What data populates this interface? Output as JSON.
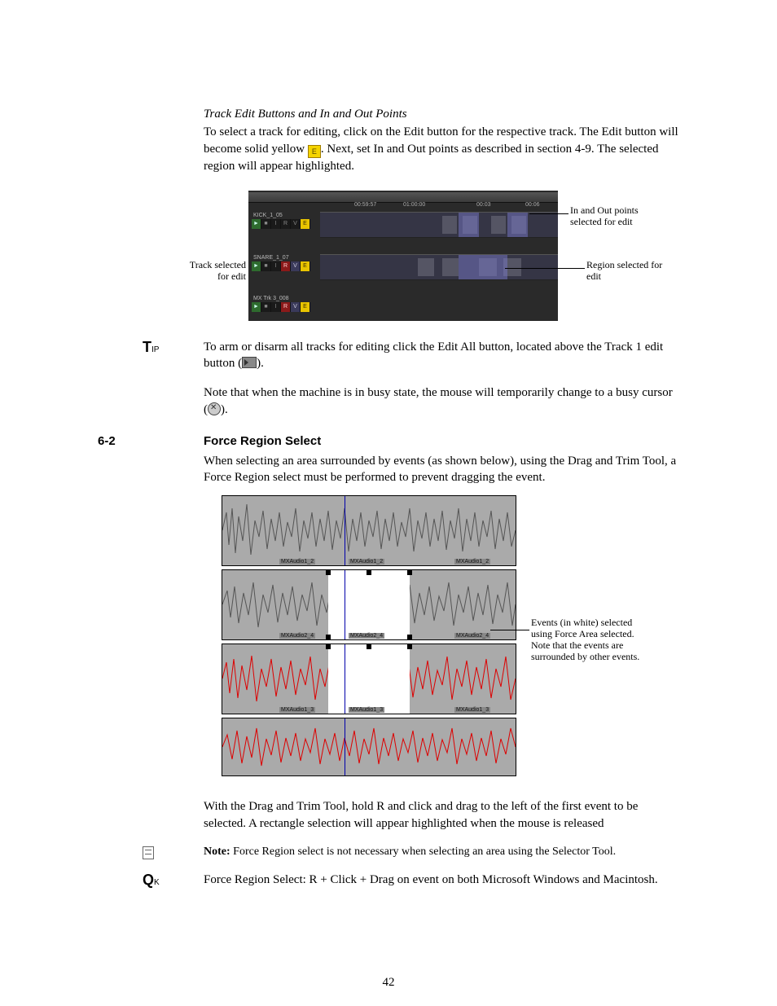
{
  "heading1": "Track Edit Buttons and In and Out Points",
  "para1a": "To select a track for editing, click on the Edit button for the respective track. The Edit button will become solid yellow ",
  "para1b": ". Next, set In and Out points as described in section 4-9. The selected region will appear highlighted.",
  "fig1": {
    "times": [
      "00:59:57",
      "01:00:00",
      "00:03",
      "00:06"
    ],
    "track_names": [
      "KICK_1_05",
      "SNARE_1_07",
      "MX Trk 3_008"
    ],
    "buttons": [
      "►",
      "■",
      "I",
      "R",
      "V",
      "E"
    ],
    "callout_left": "Track selected for edit",
    "callout_tr": "In and Out points selected for edit",
    "callout_r": "Region selected for edit"
  },
  "tip_label": "T",
  "tip_sub": "IP",
  "tip_para": "To arm or disarm all tracks for editing click the Edit All button, located above the Track 1 edit button (",
  "tip_para_end": ").",
  "busy_para_a": "Note that when the machine is in busy state, the mouse will temporarily change to a busy cursor (",
  "busy_para_b": ").",
  "section_num": "6-2",
  "section_title": "Force Region Select",
  "para2": "When selecting an area surrounded by events (as shown below), using the Drag and Trim Tool, a Force Region select must be performed to prevent dragging the event.",
  "fig2": {
    "labels_row1": [
      "MXAudio1_2",
      "MXAudio1_2",
      "MXAudio1_2"
    ],
    "labels_row2": [
      "MXAudio2_4",
      "MXAudio2_4",
      "MXAudio2_4"
    ],
    "labels_row3": [
      "MXAudio1_3",
      "MXAudio1_3",
      "MXAudio1_3"
    ],
    "callout": "Events (in white) selected using Force Area selected. Note that the events are surrounded by other events."
  },
  "para3": "With the Drag and Trim Tool, hold R and click and drag to the left of the first event to be selected. A rectangle selection will appear highlighted when the mouse is released",
  "note_bold": "Note:",
  "note_text": " Force Region select is not necessary when selecting an area using the Selector Tool.",
  "qk_label": "Q",
  "qk_sub": "K",
  "qk_text": "Force Region Select: R + Click + Drag on event on both Microsoft Windows and Macintosh.",
  "page_number": "42"
}
